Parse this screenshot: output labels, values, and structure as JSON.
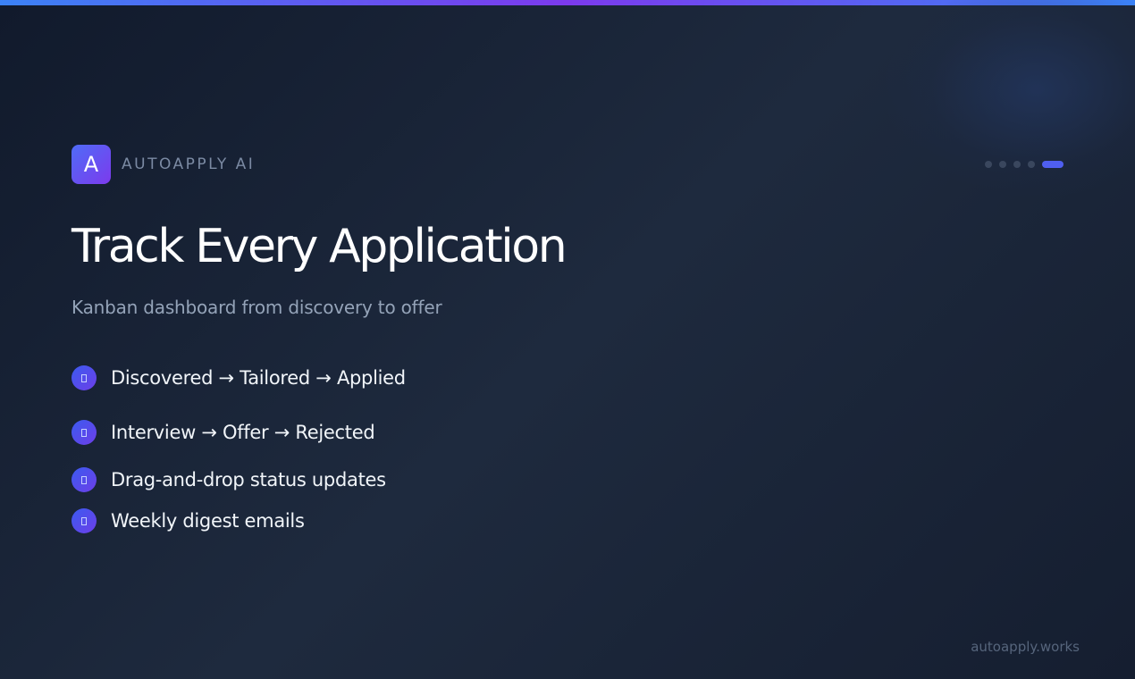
{
  "brand": {
    "logo_letter": "A",
    "name": "AUTOAPPLY AI"
  },
  "slide": {
    "title": "Track Every Application",
    "subtitle": "Kanban dashboard from discovery to offer",
    "features": [
      {
        "text": "Discovered → Tailored → Applied",
        "icon": "feature-glyph-icon"
      },
      {
        "text": "Interview → Offer → Rejected",
        "icon": "feature-glyph-icon"
      },
      {
        "text": "Drag-and-drop status updates",
        "icon": "feature-glyph-icon"
      },
      {
        "text": "Weekly digest emails",
        "icon": "feature-glyph-icon"
      }
    ]
  },
  "pager": {
    "total": 5,
    "current": 5
  },
  "footer": {
    "url": "autoapply.works"
  },
  "colors": {
    "accent": "#4f5ff0",
    "accent_purple": "#7c3aed",
    "background": "#18233a"
  }
}
